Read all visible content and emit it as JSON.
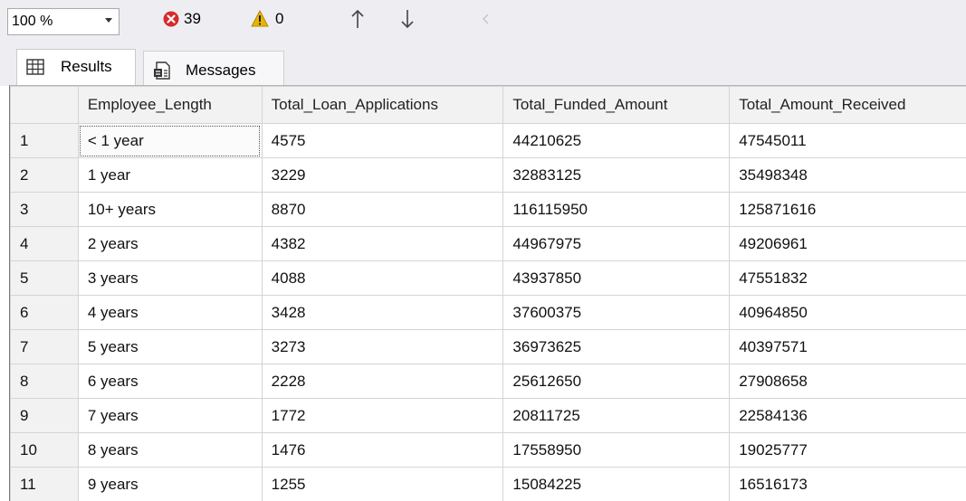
{
  "toolbar": {
    "zoom": "100 %",
    "error_count": "39",
    "warning_count": "0",
    "colors": {
      "error": "#d62b2b",
      "warning": "#e8b400"
    },
    "icons": [
      "chevron-down-icon",
      "error-icon",
      "warning-icon",
      "up-arrow-icon",
      "down-arrow-icon",
      "left-arrow-icon"
    ]
  },
  "tabs": [
    {
      "label": "Results",
      "icon": "grid-icon",
      "active": true
    },
    {
      "label": "Messages",
      "icon": "messages-icon",
      "active": false
    }
  ],
  "grid": {
    "columns": [
      "Employee_Length",
      "Total_Loan_Applications",
      "Total_Funded_Amount",
      "Total_Amount_Received"
    ],
    "rows": [
      {
        "n": "1",
        "cells": [
          "< 1 year",
          "4575",
          "44210625",
          "47545011"
        ]
      },
      {
        "n": "2",
        "cells": [
          "1 year",
          "3229",
          "32883125",
          "35498348"
        ]
      },
      {
        "n": "3",
        "cells": [
          "10+ years",
          "8870",
          "116115950",
          "125871616"
        ]
      },
      {
        "n": "4",
        "cells": [
          "2 years",
          "4382",
          "44967975",
          "49206961"
        ]
      },
      {
        "n": "5",
        "cells": [
          "3 years",
          "4088",
          "43937850",
          "47551832"
        ]
      },
      {
        "n": "6",
        "cells": [
          "4 years",
          "3428",
          "37600375",
          "40964850"
        ]
      },
      {
        "n": "7",
        "cells": [
          "5 years",
          "3273",
          "36973625",
          "40397571"
        ]
      },
      {
        "n": "8",
        "cells": [
          "6 years",
          "2228",
          "25612650",
          "27908658"
        ]
      },
      {
        "n": "9",
        "cells": [
          "7 years",
          "1772",
          "20811725",
          "22584136"
        ]
      },
      {
        "n": "10",
        "cells": [
          "8 years",
          "1476",
          "17558950",
          "19025777"
        ]
      },
      {
        "n": "11",
        "cells": [
          "9 years",
          "1255",
          "15084225",
          "16516173"
        ]
      }
    ]
  }
}
